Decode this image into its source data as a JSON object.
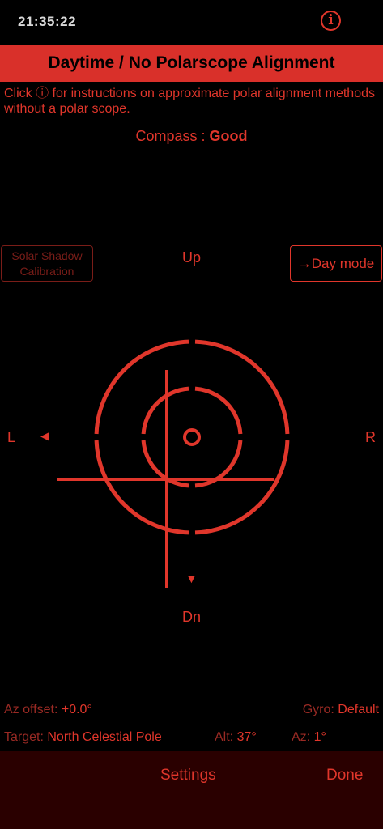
{
  "status": {
    "time": "21:35:22"
  },
  "info_icon": {
    "glyph": "i",
    "icon": "info-icon"
  },
  "header": {
    "title": "Daytime / No Polarscope Alignment"
  },
  "description": "Click ⓘ for instructions on approximate polar alignment methods without a polar scope.",
  "compass": {
    "label": "Compass : ",
    "value": "Good"
  },
  "solar_button": {
    "line1": "Solar Shadow",
    "line2": "Calibration"
  },
  "day_mode_button": {
    "label": "→Day mode"
  },
  "directions": {
    "up": "Up",
    "down": "Dn",
    "left": "L",
    "right": "R",
    "left_arrow": "◀",
    "down_arrow": "▼"
  },
  "readouts": {
    "az_offset_label": "Az offset: ",
    "az_offset_value": "+0.0°",
    "gyro_label": "Gyro: ",
    "gyro_value": "Default",
    "target_label": "Target: ",
    "target_value": "North Celestial Pole",
    "alt_label": "Alt: ",
    "alt_value": "37°",
    "az_label": "Az: ",
    "az_value": "1°"
  },
  "toolbar": {
    "settings": "Settings",
    "done": "Done"
  },
  "colors": {
    "accent": "#e0362b",
    "title_bar": "#d9302a",
    "dim": "#7a1d18",
    "toolbar_bg": "#2a0000"
  }
}
